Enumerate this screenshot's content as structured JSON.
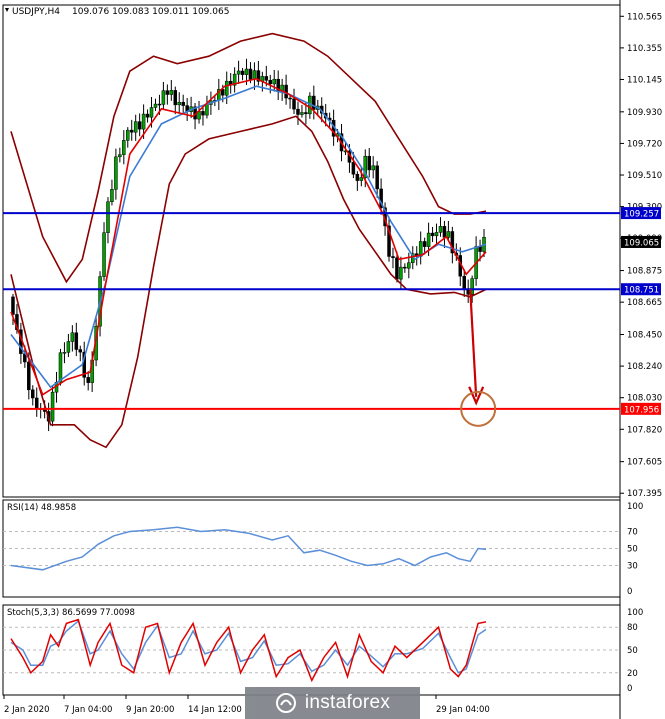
{
  "chart_data": {
    "type": "candlestick",
    "symbol": "USDJPY,H4",
    "ohlc_readout": [
      "109.076",
      "109.083",
      "109.011",
      "109.065"
    ],
    "price_axis": {
      "range": [
        107.37,
        110.64
      ],
      "ticks": [
        "110.565",
        "110.355",
        "110.145",
        "109.930",
        "109.720",
        "109.510",
        "109.300",
        "109.090",
        "108.875",
        "108.665",
        "108.450",
        "108.240",
        "108.030",
        "107.820",
        "107.605",
        "107.395"
      ]
    },
    "horizontal_levels": [
      {
        "value": 109.257,
        "label": "109.257",
        "color": "#0000cc"
      },
      {
        "value": 108.751,
        "label": "108.751",
        "color": "#0000cc"
      },
      {
        "value": 107.956,
        "label": "107.956",
        "color": "#ff0000"
      }
    ],
    "current_price": {
      "value": 109.065,
      "label": "109.065"
    },
    "time_axis": [
      "2 Jan 2020",
      "7 Jan 04:00",
      "9 Jan 20:00",
      "14 Jan 12:00",
      "29 Jan 04:00"
    ],
    "bar_count": 120,
    "price_path": [
      [
        0,
        108.7
      ],
      [
        6,
        108.0
      ],
      [
        10,
        107.9
      ],
      [
        13,
        108.3
      ],
      [
        16,
        108.45
      ],
      [
        18,
        108.3
      ],
      [
        20,
        108.1
      ],
      [
        22,
        108.5
      ],
      [
        24,
        109.15
      ],
      [
        27,
        109.6
      ],
      [
        30,
        109.8
      ],
      [
        33,
        109.85
      ],
      [
        36,
        109.95
      ],
      [
        38,
        110.0
      ],
      [
        40,
        110.08
      ],
      [
        42,
        110.0
      ],
      [
        45,
        109.95
      ],
      [
        48,
        109.9
      ],
      [
        51,
        110.0
      ],
      [
        55,
        110.1
      ],
      [
        58,
        110.2
      ],
      [
        61,
        110.18
      ],
      [
        64,
        110.15
      ],
      [
        67,
        110.12
      ],
      [
        70,
        110.05
      ],
      [
        72,
        109.95
      ],
      [
        74,
        109.9
      ],
      [
        76,
        110.0
      ],
      [
        78,
        109.95
      ],
      [
        80,
        109.9
      ],
      [
        82,
        109.8
      ],
      [
        84,
        109.7
      ],
      [
        86,
        109.6
      ],
      [
        88,
        109.45
      ],
      [
        90,
        109.6
      ],
      [
        92,
        109.55
      ],
      [
        94,
        109.3
      ],
      [
        96,
        109.0
      ],
      [
        98,
        108.85
      ],
      [
        100,
        108.9
      ],
      [
        103,
        109.0
      ],
      [
        106,
        109.1
      ],
      [
        109,
        109.15
      ],
      [
        111,
        109.1
      ],
      [
        113,
        108.95
      ],
      [
        115,
        108.75
      ],
      [
        116,
        108.7
      ],
      [
        118,
        109.0
      ],
      [
        120,
        109.07
      ]
    ],
    "bollinger_mid": [
      [
        0,
        108.45
      ],
      [
        10,
        108.1
      ],
      [
        18,
        108.25
      ],
      [
        24,
        108.8
      ],
      [
        30,
        109.5
      ],
      [
        38,
        109.85
      ],
      [
        46,
        109.95
      ],
      [
        54,
        110.02
      ],
      [
        62,
        110.1
      ],
      [
        70,
        110.05
      ],
      [
        78,
        109.95
      ],
      [
        84,
        109.75
      ],
      [
        90,
        109.5
      ],
      [
        96,
        109.2
      ],
      [
        102,
        108.95
      ],
      [
        108,
        109.05
      ],
      [
        114,
        109.0
      ],
      [
        120,
        109.05
      ]
    ],
    "bollinger_upper": [
      [
        0,
        109.8
      ],
      [
        8,
        109.1
      ],
      [
        14,
        108.8
      ],
      [
        18,
        108.95
      ],
      [
        22,
        109.4
      ],
      [
        26,
        109.9
      ],
      [
        30,
        110.2
      ],
      [
        36,
        110.3
      ],
      [
        42,
        110.25
      ],
      [
        50,
        110.3
      ],
      [
        58,
        110.4
      ],
      [
        66,
        110.45
      ],
      [
        74,
        110.4
      ],
      [
        80,
        110.3
      ],
      [
        86,
        110.15
      ],
      [
        92,
        110.0
      ],
      [
        98,
        109.75
      ],
      [
        104,
        109.5
      ],
      [
        108,
        109.3
      ],
      [
        112,
        109.25
      ],
      [
        116,
        109.25
      ],
      [
        120,
        109.27
      ]
    ],
    "bollinger_lower": [
      [
        0,
        108.85
      ],
      [
        6,
        108.2
      ],
      [
        10,
        107.85
      ],
      [
        16,
        107.85
      ],
      [
        20,
        107.75
      ],
      [
        24,
        107.7
      ],
      [
        28,
        107.85
      ],
      [
        32,
        108.3
      ],
      [
        36,
        108.9
      ],
      [
        40,
        109.45
      ],
      [
        44,
        109.65
      ],
      [
        50,
        109.75
      ],
      [
        58,
        109.8
      ],
      [
        66,
        109.85
      ],
      [
        72,
        109.9
      ],
      [
        76,
        109.8
      ],
      [
        80,
        109.6
      ],
      [
        84,
        109.35
      ],
      [
        88,
        109.15
      ],
      [
        92,
        109.0
      ],
      [
        96,
        108.85
      ],
      [
        100,
        108.75
      ],
      [
        106,
        108.72
      ],
      [
        112,
        108.73
      ],
      [
        116,
        108.7
      ],
      [
        120,
        108.75
      ]
    ],
    "ma_fast": [
      [
        0,
        108.6
      ],
      [
        8,
        108.05
      ],
      [
        14,
        108.15
      ],
      [
        20,
        108.2
      ],
      [
        24,
        108.8
      ],
      [
        30,
        109.65
      ],
      [
        38,
        109.95
      ],
      [
        46,
        109.9
      ],
      [
        54,
        110.1
      ],
      [
        62,
        110.15
      ],
      [
        70,
        110.05
      ],
      [
        76,
        109.95
      ],
      [
        82,
        109.78
      ],
      [
        88,
        109.55
      ],
      [
        94,
        109.25
      ],
      [
        98,
        108.95
      ],
      [
        104,
        108.98
      ],
      [
        110,
        109.1
      ],
      [
        115,
        108.85
      ],
      [
        120,
        109.0
      ]
    ],
    "rsi": {
      "label": "RSI(14) 48.9858",
      "scale": [
        0,
        100
      ],
      "levels": [
        "100",
        "70",
        "50",
        "30",
        "0"
      ],
      "values": [
        [
          0,
          30
        ],
        [
          8,
          25
        ],
        [
          14,
          35
        ],
        [
          18,
          40
        ],
        [
          22,
          55
        ],
        [
          26,
          65
        ],
        [
          30,
          70
        ],
        [
          36,
          72
        ],
        [
          42,
          75
        ],
        [
          48,
          70
        ],
        [
          54,
          72
        ],
        [
          60,
          68
        ],
        [
          66,
          60
        ],
        [
          70,
          65
        ],
        [
          74,
          45
        ],
        [
          78,
          48
        ],
        [
          82,
          42
        ],
        [
          86,
          35
        ],
        [
          90,
          30
        ],
        [
          94,
          32
        ],
        [
          98,
          38
        ],
        [
          102,
          30
        ],
        [
          106,
          40
        ],
        [
          110,
          45
        ],
        [
          113,
          38
        ],
        [
          116,
          35
        ],
        [
          118,
          50
        ],
        [
          120,
          49
        ]
      ]
    },
    "stochastic": {
      "label": "Stoch(5,3,3) 86.5699 77.0098",
      "scale": [
        0,
        100
      ],
      "levels": [
        "100",
        "80",
        "50",
        "20",
        "0"
      ],
      "main": [
        [
          0,
          65
        ],
        [
          3,
          40
        ],
        [
          5,
          20
        ],
        [
          8,
          35
        ],
        [
          10,
          70
        ],
        [
          12,
          55
        ],
        [
          14,
          85
        ],
        [
          17,
          90
        ],
        [
          20,
          30
        ],
        [
          22,
          60
        ],
        [
          25,
          85
        ],
        [
          28,
          30
        ],
        [
          31,
          20
        ],
        [
          34,
          80
        ],
        [
          37,
          85
        ],
        [
          40,
          20
        ],
        [
          43,
          60
        ],
        [
          46,
          85
        ],
        [
          49,
          30
        ],
        [
          52,
          60
        ],
        [
          55,
          80
        ],
        [
          58,
          20
        ],
        [
          61,
          50
        ],
        [
          64,
          70
        ],
        [
          67,
          15
        ],
        [
          70,
          40
        ],
        [
          73,
          50
        ],
        [
          76,
          10
        ],
        [
          79,
          40
        ],
        [
          82,
          60
        ],
        [
          85,
          15
        ],
        [
          88,
          70
        ],
        [
          91,
          35
        ],
        [
          94,
          20
        ],
        [
          97,
          55
        ],
        [
          100,
          40
        ],
        [
          104,
          60
        ],
        [
          108,
          80
        ],
        [
          111,
          25
        ],
        [
          113,
          15
        ],
        [
          115,
          30
        ],
        [
          118,
          85
        ],
        [
          120,
          87
        ]
      ],
      "signal": [
        [
          0,
          60
        ],
        [
          3,
          50
        ],
        [
          5,
          30
        ],
        [
          8,
          30
        ],
        [
          10,
          55
        ],
        [
          12,
          60
        ],
        [
          14,
          75
        ],
        [
          17,
          88
        ],
        [
          20,
          45
        ],
        [
          22,
          50
        ],
        [
          25,
          75
        ],
        [
          28,
          45
        ],
        [
          31,
          25
        ],
        [
          34,
          60
        ],
        [
          37,
          82
        ],
        [
          40,
          40
        ],
        [
          43,
          45
        ],
        [
          46,
          75
        ],
        [
          49,
          45
        ],
        [
          52,
          50
        ],
        [
          55,
          72
        ],
        [
          58,
          35
        ],
        [
          61,
          40
        ],
        [
          64,
          62
        ],
        [
          67,
          30
        ],
        [
          70,
          32
        ],
        [
          73,
          45
        ],
        [
          76,
          22
        ],
        [
          79,
          30
        ],
        [
          82,
          50
        ],
        [
          85,
          30
        ],
        [
          88,
          55
        ],
        [
          91,
          42
        ],
        [
          94,
          28
        ],
        [
          97,
          45
        ],
        [
          100,
          45
        ],
        [
          104,
          52
        ],
        [
          108,
          72
        ],
        [
          111,
          40
        ],
        [
          113,
          20
        ],
        [
          115,
          25
        ],
        [
          118,
          70
        ],
        [
          120,
          77
        ]
      ]
    },
    "annotation": {
      "type": "arrow",
      "from": {
        "bar": 115,
        "price": 108.75
      },
      "to": {
        "bar": 116,
        "price": 107.956
      },
      "target_price": 107.956,
      "color": "#cc0000"
    }
  },
  "watermark": {
    "text": "instaforex"
  }
}
